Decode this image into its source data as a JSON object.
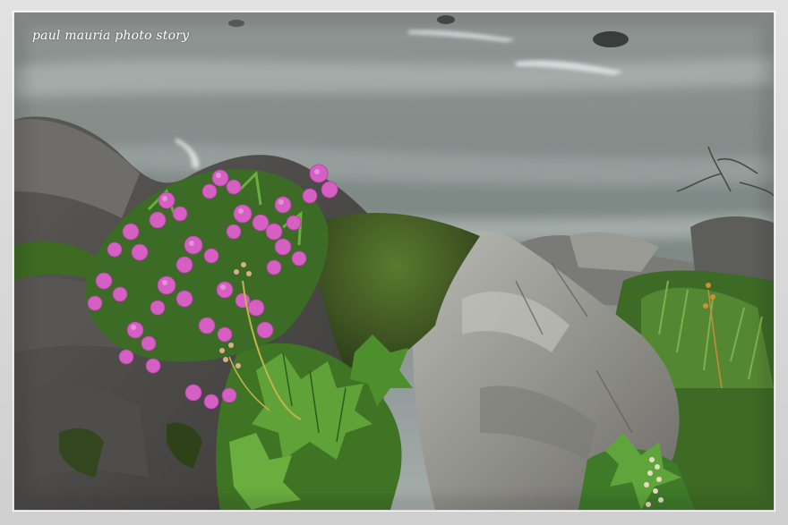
{
  "watermark": {
    "text": "paul mauria photo story"
  },
  "scene": {
    "subject": "pink-azalea-flowers",
    "colors": {
      "river": "#8a9491",
      "rock": "#8d8d88",
      "moss": "#3f5a26",
      "leaf": "#4f8a2c",
      "flower": "#d45fc2",
      "frame": "#d9d9d9"
    }
  }
}
